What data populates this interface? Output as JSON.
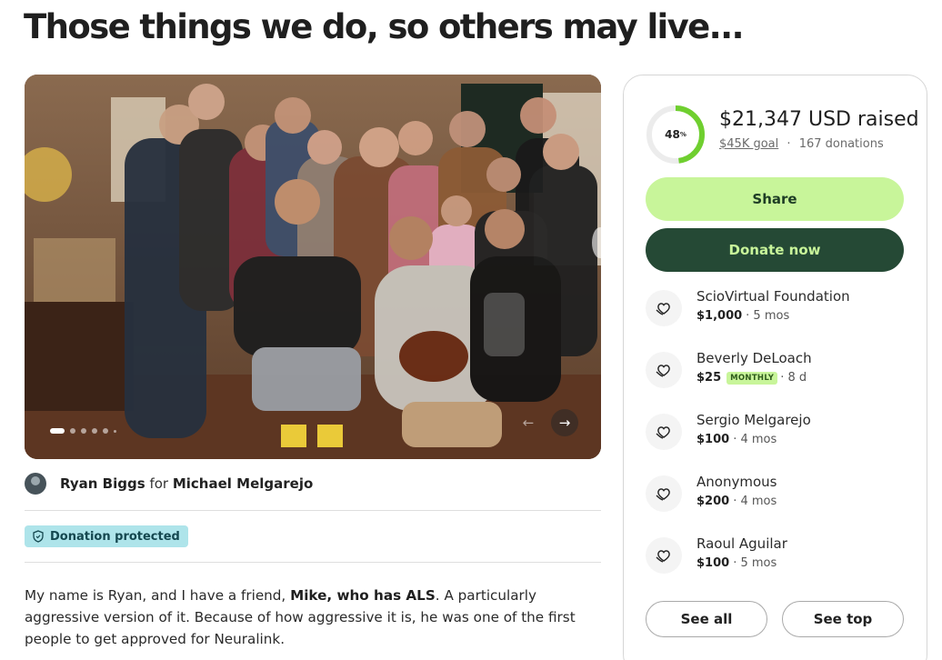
{
  "page": {
    "title": "Those things we do, so others may live..."
  },
  "organizer": {
    "organizer_name": "Ryan Biggs",
    "connector": "for",
    "beneficiary_name": "Michael Melgarejo"
  },
  "protection": {
    "label": "Donation protected"
  },
  "story": {
    "part1": "My name is Ryan, and I have a friend, ",
    "bold": "Mike, who has ALS",
    "part2": ". A particularly aggressive version of it. Because of how aggressive it is, he was one of the first people to get approved for Neuralink."
  },
  "fundraiser": {
    "percent": 48,
    "percent_label": "48",
    "percent_sign": "%",
    "raised_text": "$21,347 USD raised",
    "goal_text": "$45K goal",
    "separator": "·",
    "donations_text": "167 donations",
    "share_label": "Share",
    "donate_label": "Donate now",
    "see_all_label": "See all",
    "see_top_label": "See top"
  },
  "donations": [
    {
      "name": "ScioVirtual Foundation",
      "amount": "$1,000",
      "badge": "",
      "time": "· 5 mos"
    },
    {
      "name": "Beverly DeLoach",
      "amount": "$25",
      "badge": "MONTHLY",
      "time": "· 8 d"
    },
    {
      "name": "Sergio Melgarejo",
      "amount": "$100",
      "badge": "",
      "time": "· 4 mos"
    },
    {
      "name": "Anonymous",
      "amount": "$200",
      "badge": "",
      "time": "· 4 mos"
    },
    {
      "name": "Raoul Aguilar",
      "amount": "$100",
      "badge": "",
      "time": "· 5 mos"
    }
  ],
  "carousel": {
    "prev_icon": "←",
    "next_icon": "→",
    "slides": 6,
    "active_slide": 1
  },
  "colors": {
    "accent_light": "#c8f59a",
    "accent_dark": "#254935",
    "progress_track": "#ececec",
    "progress_fill": "#6fcf2f",
    "protected_bg": "#aee4ea"
  },
  "icons": {
    "donation": "hand-heart-icon",
    "protected": "shield-icon"
  }
}
